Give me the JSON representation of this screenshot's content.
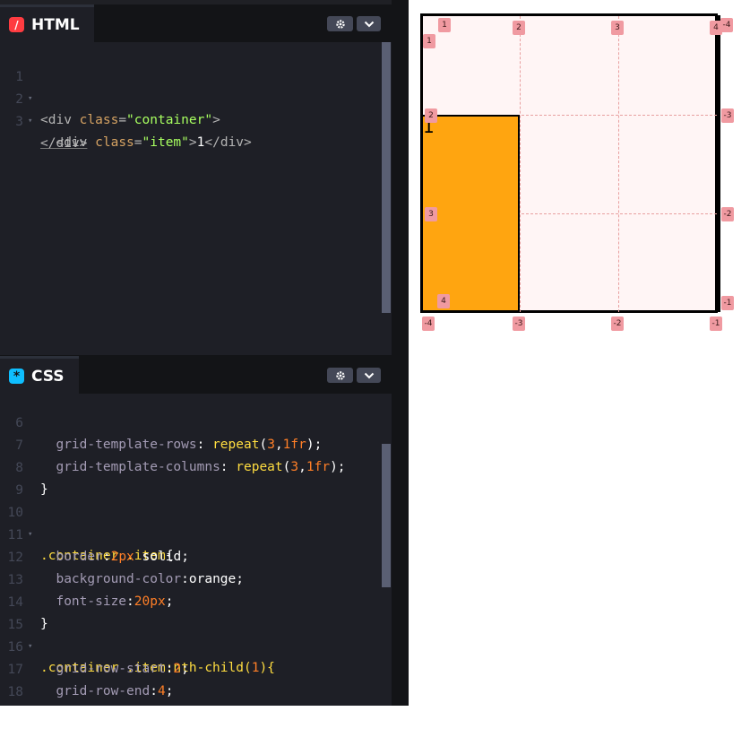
{
  "html_panel": {
    "tab_label": "HTML",
    "tab_icon": "/",
    "lines": [
      {
        "num": "1",
        "fold": true
      },
      {
        "num": "2",
        "fold": true
      },
      {
        "num": "3",
        "fold": false
      }
    ],
    "code": {
      "l1_tag_open": "<div ",
      "l1_attr": "class",
      "l1_eq": "=",
      "l1_str": "\"container\"",
      "l1_close": ">",
      "l2_tag_open": "<div ",
      "l2_attr": "class",
      "l2_eq": "=",
      "l2_str": "\"item\"",
      "l2_close": ">",
      "l2_text": "1",
      "l2_end": "</div>",
      "l3_end": "</div>"
    }
  },
  "css_panel": {
    "tab_label": "CSS",
    "tab_icon": "*",
    "lines": [
      {
        "num": "6"
      },
      {
        "num": "7"
      },
      {
        "num": "8"
      },
      {
        "num": "9"
      },
      {
        "num": "10"
      },
      {
        "num": "11"
      },
      {
        "num": "12"
      },
      {
        "num": "13"
      },
      {
        "num": "14"
      },
      {
        "num": "15"
      },
      {
        "num": "16"
      },
      {
        "num": "17"
      },
      {
        "num": "18"
      }
    ],
    "code": {
      "l6_prop": "grid-template-rows",
      "l6_fn": "repeat",
      "l6_n": "3",
      "l6_fr": "1fr",
      "l7_prop": "grid-template-columns",
      "l7_fn": "repeat",
      "l7_n": "3",
      "l7_fr": "1fr",
      "l8": "}",
      "l10_sel": ".container .item",
      "l10_brace": "{",
      "l11_prop": "border",
      "l11_num": "2px",
      "l11_val": "solid",
      "l12_prop": "background-color",
      "l12_val": "orange",
      "l13_prop": "font-size",
      "l13_num": "20px",
      "l14": "}",
      "l15_sel": ".container .item:nth-child(",
      "l15_num": "1",
      "l15_rest": "){",
      "l16_prop": "grid-row-start",
      "l16_num": "2",
      "l17_prop": "grid-row-end",
      "l17_num": "4",
      "l18": "}"
    }
  },
  "preview": {
    "item_text": "1",
    "badges": {
      "top_1": "1",
      "top_2": "2",
      "top_3": "3",
      "top_4": "4",
      "top_neg4": "-4",
      "left_1": "1",
      "left_2": "2",
      "left_3": "3",
      "left_4": "4",
      "right_neg3": "-3",
      "right_neg2": "-2",
      "right_neg1": "-1",
      "bottom_neg4": "-4",
      "bottom_neg3": "-3",
      "bottom_neg2": "-2",
      "bottom_neg1": "-1"
    }
  },
  "colors": {
    "editor_bg": "#1e1f26",
    "item_bg": "#ffa510",
    "badge_bg": "#f09aa1"
  },
  "icons": {
    "settings": "gear-icon",
    "collapse": "chevron-down-icon"
  }
}
